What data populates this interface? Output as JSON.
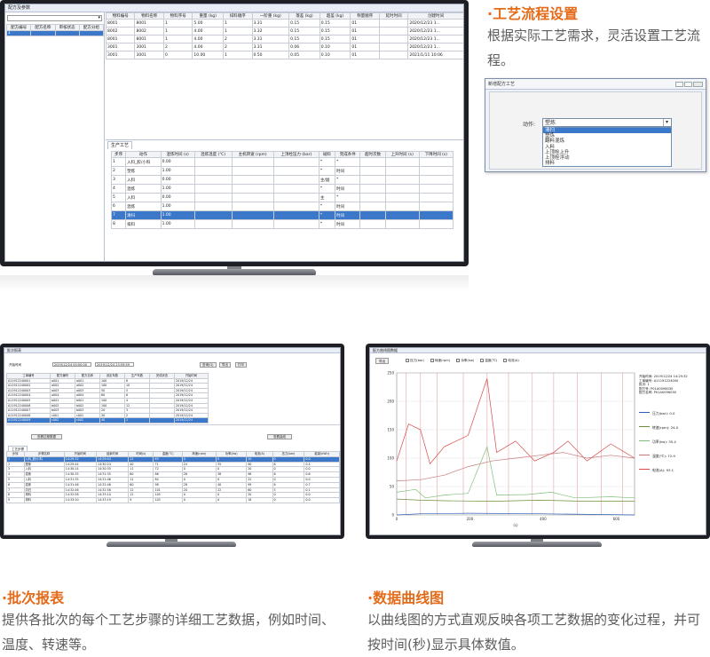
{
  "monitor_main": {
    "window_title": "配方及参数",
    "left_table": {
      "headers": [
        "配方编号",
        "配方名称",
        "审核状态",
        "配方分组"
      ],
      "rows": [
        [
          "1",
          "",
          "",
          ""
        ]
      ]
    },
    "material_table": {
      "headers": [
        "物料编号",
        "物料名称",
        "物料序号",
        "重量 (kg)",
        "排料顺序",
        "一阶重 (kg)",
        "落差 (kg)",
        "超差 (kg)",
        "称量顺序",
        "延时时间",
        "创建时间"
      ],
      "rows": [
        [
          "8001",
          "8001",
          "1",
          "5.00",
          "1",
          "3.31",
          "0.15",
          "0.15",
          "01",
          "",
          "2020/12/23 1..."
        ],
        [
          "8002",
          "8002",
          "1",
          "4.00",
          "1",
          "3.32",
          "0.15",
          "0.15",
          "01",
          "",
          "2020/12/23 1..."
        ],
        [
          "8001",
          "8001",
          "1",
          "4.00",
          "2",
          "3.31",
          "0.15",
          "0.15",
          "01",
          "",
          "2020/12/23 1..."
        ],
        [
          "3001",
          "3001",
          "2",
          "4.00",
          "2",
          "3.31",
          "0.06",
          "0.10",
          "01",
          "",
          "2020/12/23 1..."
        ],
        [
          "3001",
          "3001",
          "0",
          "10.00",
          "1",
          "0.50",
          "0.05",
          "0.10",
          "01",
          "",
          "2021/1/11 10:06"
        ]
      ]
    },
    "process_tab": "生产工艺",
    "process_table": {
      "headers": [
        "步序",
        "动作",
        "混炼时间 (s)",
        "混炼温度 (℃)",
        "主机转速 (rpm)",
        "上顶栓压力 (bar)",
        "碰料",
        "完成条件",
        "超时次数",
        "上升时间 (s)",
        "下降时间 (s)"
      ],
      "rows": [
        [
          "1",
          "入料_胶/小料",
          "0.00",
          "",
          "",
          "",
          "*",
          "*",
          "",
          "",
          ""
        ],
        [
          "2",
          "塑炼",
          "1.00",
          "",
          "",
          "",
          "*",
          "时间",
          "",
          "",
          ""
        ],
        [
          "3",
          "入料",
          "0.00",
          "",
          "",
          "",
          "主/副",
          "*",
          "",
          "",
          ""
        ],
        [
          "4",
          "混炼",
          "1.00",
          "",
          "",
          "",
          "*",
          "时间",
          "",
          "",
          ""
        ],
        [
          "5",
          "入料",
          "0.00",
          "",
          "",
          "",
          "主",
          "*",
          "",
          "",
          ""
        ],
        [
          "6",
          "混炼",
          "1.00",
          "",
          "",
          "",
          "*",
          "时间",
          "",
          "",
          ""
        ],
        [
          "7",
          "清扫",
          "1.00",
          "",
          "",
          "",
          "*",
          "时间",
          "",
          "",
          ""
        ],
        [
          "8",
          "排料",
          "1.00",
          "",
          "",
          "",
          "*",
          "时间",
          "",
          "",
          ""
        ]
      ],
      "selected_row": 6
    }
  },
  "section_process": {
    "title": "·工艺流程设置",
    "body": "根据实际工艺需求，灵活设置工艺流程。",
    "dialog": {
      "title": "新增配方工艺",
      "field_label": "动作:",
      "field_value": "塑炼",
      "options": [
        "清扫",
        "塑炼",
        "翻料混炼",
        "入料",
        "上顶栓上升",
        "上顶栓浮动",
        "排料"
      ]
    }
  },
  "monitor_batch": {
    "window_title": "批次报表",
    "filters": {
      "start_label": "开始时间",
      "start_value": "2019/12/24 00:00:00",
      "end_value": "2019/12/24 23:59:59",
      "query_button": "查询(Q)",
      "export_button": "导出",
      "print_button": "打印"
    },
    "batch_headers": [
      "工单编号",
      "配方编号",
      "配方名称",
      "设定车数",
      "生产车数",
      "完成状态",
      "开始时间"
    ],
    "batch_rows": [
      [
        "A11912240001",
        "a001",
        "a001",
        "100",
        "8",
        "",
        "2019/12/24"
      ],
      [
        "A11912240002",
        "a002",
        "a002",
        "100",
        "10",
        "",
        "2019/12/24"
      ],
      [
        "A11912240003",
        "a003",
        "a003",
        "50",
        "5",
        "",
        "2019/12/24"
      ],
      [
        "A11912240004",
        "a004",
        "a004",
        "60",
        "6",
        "",
        "2019/12/24"
      ],
      [
        "A11912240005",
        "b001",
        "b001",
        "100",
        "4",
        "",
        "2019/12/24"
      ],
      [
        "A11912240006",
        "b002",
        "b002",
        "100",
        "12",
        "",
        "2019/12/24"
      ],
      [
        "A11912240007",
        "b003",
        "b003",
        "20",
        "3",
        "",
        "2019/12/24"
      ],
      [
        "A11912240008",
        "c001",
        "c001",
        "30",
        "2",
        "",
        "2019/12/24"
      ],
      [
        "A11912240009",
        "c002",
        "c002",
        "40",
        "1",
        "",
        "2019/12/24"
      ]
    ],
    "batch_selected": 8,
    "detail_button": "查看过程数据",
    "curve_button": "查看曲线",
    "step_tab": "工艺步骤",
    "step_headers": [
      "步序",
      "步骤名称",
      "开始时间",
      "结束时间",
      "时间(s)",
      "温度(℃)",
      "转速(rpm)",
      "功率(kw)",
      "电流(A)",
      "压力(bar)",
      "能量(kWh)"
    ],
    "step_rows": [
      [
        "1",
        "入料_胶/小料",
        "14:29:32",
        "14:29:44",
        "12",
        "63",
        "0",
        "0",
        "20",
        "0",
        "0.0"
      ],
      [
        "2",
        "塑炼",
        "14:29:44",
        "14:30:24",
        "40",
        "71",
        "24",
        "35",
        "90",
        "6",
        "0.4"
      ],
      [
        "3",
        "入料",
        "14:30:24",
        "14:30:35",
        "11",
        "72",
        "0",
        "0",
        "20",
        "0",
        "0.0"
      ],
      [
        "4",
        "混炼",
        "14:30:35",
        "14:31:35",
        "60",
        "86",
        "26",
        "38",
        "96",
        "6",
        "0.6"
      ],
      [
        "5",
        "入料",
        "14:31:35",
        "14:31:46",
        "11",
        "84",
        "0",
        "0",
        "22",
        "0",
        "0.0"
      ],
      [
        "6",
        "混炼",
        "14:31:46",
        "14:32:46",
        "60",
        "98",
        "28",
        "40",
        "99",
        "6",
        "0.7"
      ],
      [
        "7",
        "清扫",
        "14:32:46",
        "14:32:58",
        "12",
        "101",
        "20",
        "22",
        "60",
        "5",
        "0.1"
      ],
      [
        "8",
        "排料",
        "14:32:58",
        "14:33:10",
        "12",
        "105",
        "0",
        "0",
        "20",
        "0",
        "0.0"
      ],
      [
        "9",
        "排料",
        "14:33:10",
        "14:33:19",
        "9",
        "103",
        "0",
        "0",
        "18",
        "0",
        "0.0"
      ]
    ]
  },
  "section_batch": {
    "title": "·批次报表",
    "body": "提供各批次的每个工艺步骤的详细工艺数据，例如时间、温度、转速等。"
  },
  "monitor_curve": {
    "window_title": "配方曲线图数据",
    "toolbar_button": "导出",
    "legend_checks": [
      "压力(bar)",
      "转速(rpm)",
      "功率(kw)",
      "温度(℃)",
      "电流(A)"
    ],
    "y_ticks": [
      "250",
      "200",
      "150",
      "100",
      "50",
      "0"
    ],
    "x_ticks": [
      "0",
      "200",
      "400",
      "600"
    ],
    "x_label": "(s)",
    "info_lines": [
      "开始时间: 2019/12/24 14:29:32",
      "工单编号: A11191224000",
      "批次: 1",
      "配方号: P01A0096030",
      "配方名称: P01A0096030"
    ],
    "readouts": [
      {
        "label": "压力(bar): 0.0",
        "color": "#2b5fb3"
      },
      {
        "label": "转速(rpm): 24.0",
        "color": "#6c8f3c"
      },
      {
        "label": "功率(kw): 35.4",
        "color": "#7fbf7f"
      },
      {
        "label": "温度(℃): 72.9",
        "color": "#c9787a"
      },
      {
        "label": "电流(A): 93.1",
        "color": "#d64b4b"
      }
    ]
  },
  "section_curve": {
    "title": "·数据曲线图",
    "body": "以曲线图的方式直观反映各项工艺数据的变化过程，并可按时间(秒)显示具体数值。"
  }
}
